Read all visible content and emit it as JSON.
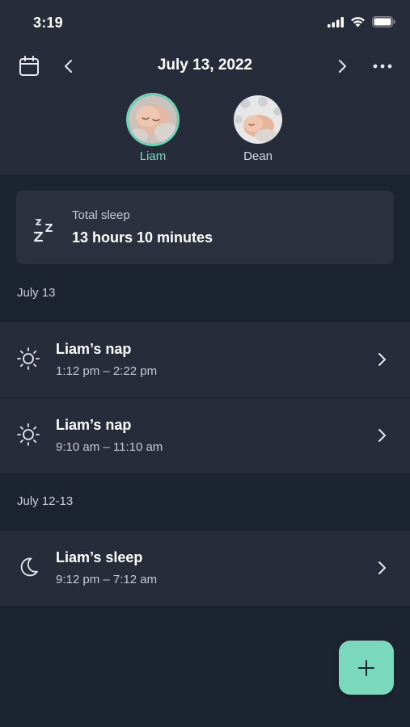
{
  "status_bar": {
    "time": "3:19"
  },
  "header": {
    "date": "July 13, 2022"
  },
  "profiles": [
    {
      "name": "Liam",
      "selected": true
    },
    {
      "name": "Dean",
      "selected": false
    }
  ],
  "summary": {
    "label": "Total sleep",
    "value": "13 hours 10 minutes"
  },
  "sections": [
    {
      "label": "July 13",
      "entries": [
        {
          "icon": "sun-icon",
          "title": "Liam’s nap",
          "time": "1:12 pm – 2:22 pm"
        },
        {
          "icon": "sun-icon",
          "title": "Liam’s nap",
          "time": "9:10 am – 11:10 am"
        }
      ]
    },
    {
      "label": "July 12-13",
      "entries": [
        {
          "icon": "moon-icon",
          "title": "Liam’s sleep",
          "time": "9:12 pm – 7:12 am"
        }
      ]
    }
  ],
  "fab": {
    "icon": "plus-icon"
  },
  "colors": {
    "background": "#1d2431",
    "panel": "#272c3a",
    "accent": "#7ad9bd"
  }
}
